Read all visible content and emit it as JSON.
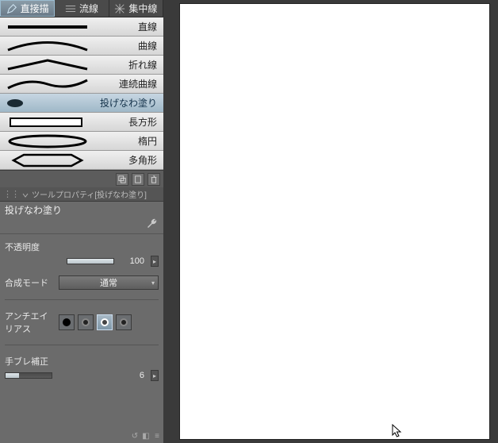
{
  "tabs": [
    {
      "label": "直接描"
    },
    {
      "label": "流線"
    },
    {
      "label": "集中線"
    }
  ],
  "subtools": [
    {
      "label": "直線"
    },
    {
      "label": "曲線"
    },
    {
      "label": "折れ線"
    },
    {
      "label": "連続曲線"
    },
    {
      "label": "投げなわ塗り"
    },
    {
      "label": "長方形"
    },
    {
      "label": "楕円"
    },
    {
      "label": "多角形"
    }
  ],
  "propertyPanel": {
    "headerTitle": "ツールプロパティ[投げなわ塗り]",
    "title": "投げなわ塗り",
    "opacity": {
      "label": "不透明度",
      "value": "100"
    },
    "blend": {
      "label": "合成モード",
      "value": "通常"
    },
    "antialias": {
      "label": "アンチエイリアス"
    },
    "stabilize": {
      "label": "手ブレ補正",
      "value": "6"
    }
  }
}
